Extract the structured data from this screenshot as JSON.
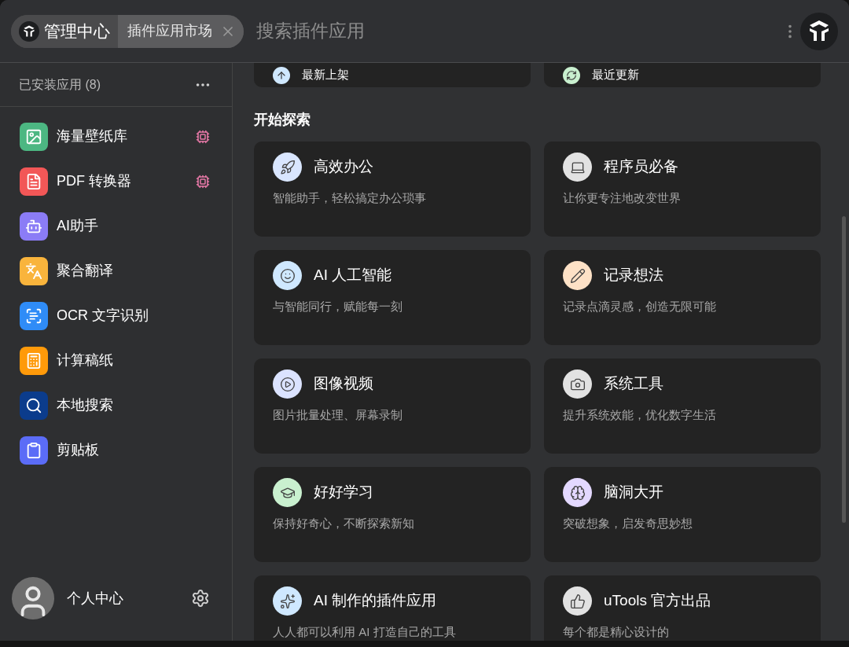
{
  "header": {
    "breadcrumb": [
      {
        "label": "管理中心",
        "selected": false
      },
      {
        "label": "插件应用市场",
        "selected": true
      }
    ],
    "search": {
      "placeholder": "搜索插件应用"
    }
  },
  "sidebar": {
    "title": "已安装应用 (8)",
    "items": [
      {
        "label": "海量壁纸库",
        "color": "#4cb782",
        "chip": true
      },
      {
        "label": "PDF 转换器",
        "color": "#f25757",
        "chip": true
      },
      {
        "label": "AI助手",
        "color": "#8b7cf6",
        "chip": false
      },
      {
        "label": "聚合翻译",
        "color": "#f9b43c",
        "chip": false
      },
      {
        "label": "OCR 文字识别",
        "color": "#2f8cf7",
        "chip": false
      },
      {
        "label": "计算稿纸",
        "color": "#ff9a0a",
        "chip": false
      },
      {
        "label": "本地搜索",
        "color": "#0b3c8c",
        "chip": false
      },
      {
        "label": "剪贴板",
        "color": "#5b6cf7",
        "chip": false
      }
    ],
    "user": {
      "label": "个人中心"
    }
  },
  "content": {
    "top_cards": [
      {
        "title": "最新上架",
        "color": "#cfe8ff"
      },
      {
        "title": "最近更新",
        "color": "#c9f0cf"
      }
    ],
    "section_title": "开始探索",
    "categories": [
      {
        "title": "高效办公",
        "subtitle": "智能助手，轻松搞定办公琐事",
        "color": "#d9e6ff"
      },
      {
        "title": "程序员必备",
        "subtitle": "让你更专注地改变世界",
        "color": "#e2e2e2"
      },
      {
        "title": "AI 人工智能",
        "subtitle": "与智能同行，赋能每一刻",
        "color": "#cfe8ff"
      },
      {
        "title": "记录想法",
        "subtitle": "记录点滴灵感，创造无限可能",
        "color": "#fde1c6"
      },
      {
        "title": "图像视频",
        "subtitle": "图片批量处理、屏幕录制",
        "color": "#dbe3ff"
      },
      {
        "title": "系统工具",
        "subtitle": "提升系统效能，优化数字生活",
        "color": "#e2e2e2"
      },
      {
        "title": "好好学习",
        "subtitle": "保持好奇心，不断探索新知",
        "color": "#c9f0cf"
      },
      {
        "title": "脑洞大开",
        "subtitle": "突破想象，启发奇思妙想",
        "color": "#e3d8ff"
      },
      {
        "title": "AI 制作的插件应用",
        "subtitle": "人人都可以利用 AI 打造自己的工具",
        "color": "#cfe8ff"
      },
      {
        "title": "uTools 官方出品",
        "subtitle": "每个都是精心设计的",
        "color": "#e2e2e2"
      }
    ]
  }
}
